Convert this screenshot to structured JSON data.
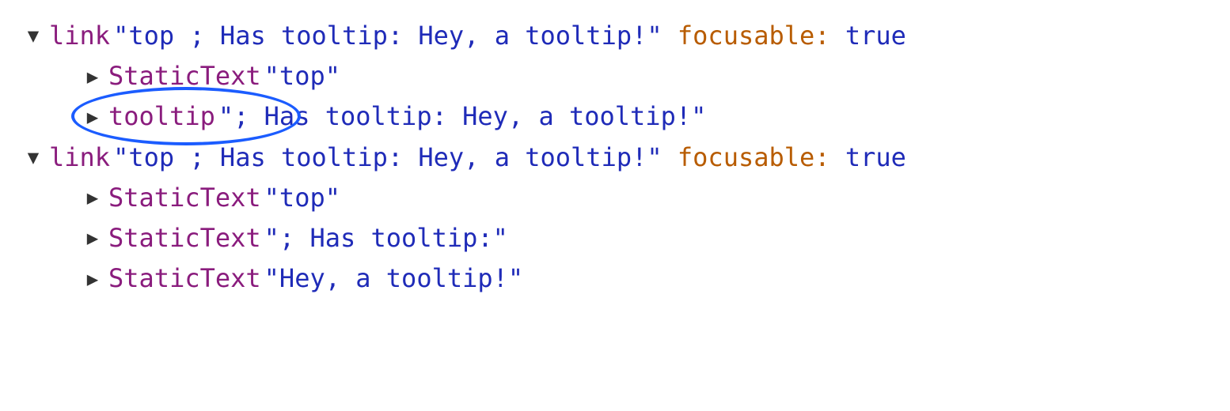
{
  "tree": {
    "node1": {
      "arrow": "▼",
      "role": "link",
      "name": "\"top ; Has tooltip: Hey, a tooltip!\"",
      "attr": "focusable",
      "colon": ":",
      "value": "true",
      "children": {
        "c1": {
          "arrow": "▶",
          "role": "StaticText",
          "name": "\"top\""
        },
        "c2": {
          "arrow": "▶",
          "role": "tooltip",
          "name_prefix": "\";",
          "name_rest": "Has tooltip: Hey, a tooltip!\""
        }
      }
    },
    "node2": {
      "arrow": "▼",
      "role": "link",
      "name": "\"top ; Has tooltip: Hey, a tooltip!\"",
      "attr": "focusable",
      "colon": ":",
      "value": "true",
      "children": {
        "c1": {
          "arrow": "▶",
          "role": "StaticText",
          "name": "\"top\""
        },
        "c2": {
          "arrow": "▶",
          "role": "StaticText",
          "name": "\"; Has tooltip:\""
        },
        "c3": {
          "arrow": "▶",
          "role": "StaticText",
          "name": "\"Hey, a tooltip!\""
        }
      }
    }
  }
}
